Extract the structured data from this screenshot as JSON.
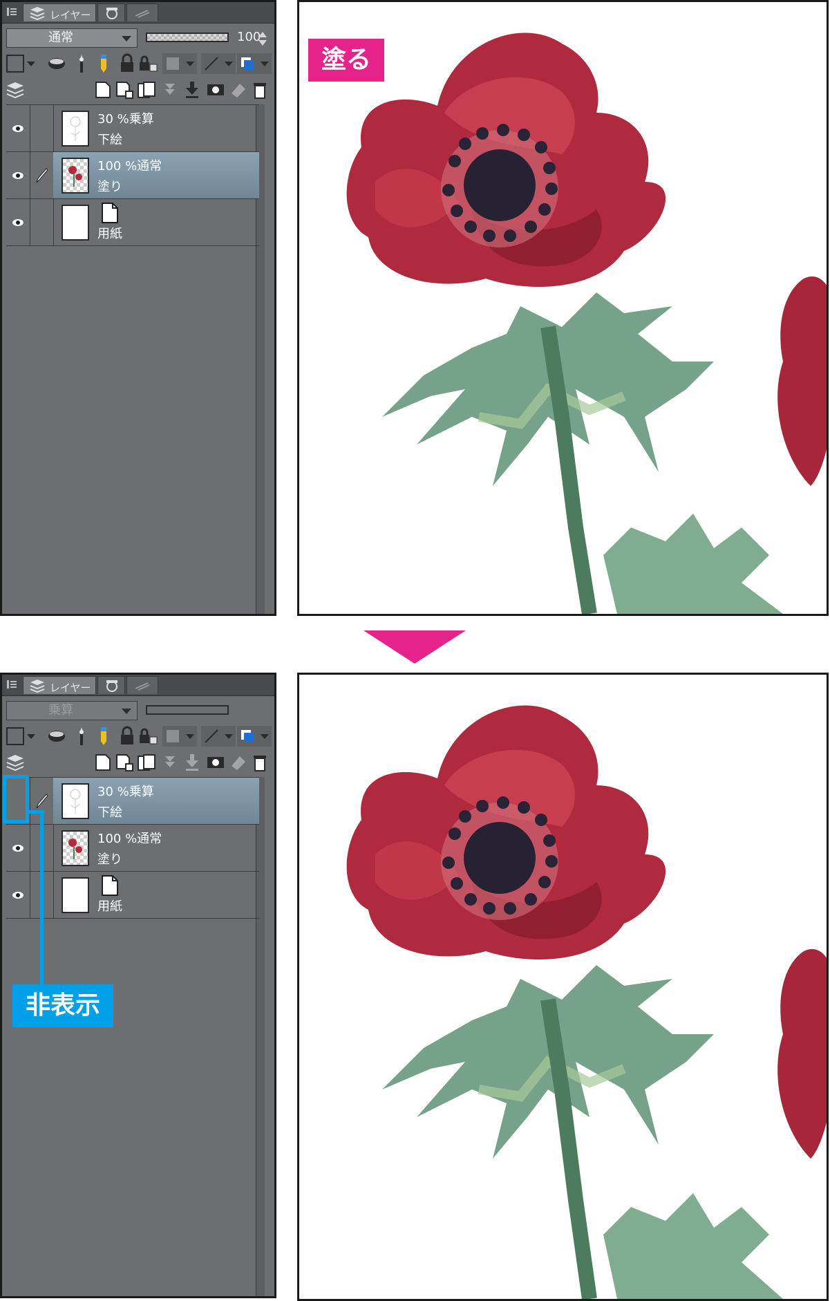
{
  "panel_tab_label": "レイヤー",
  "top_panel": {
    "blend_mode": "通常",
    "opacity": "100",
    "layers": [
      {
        "line1": "30 %乗算",
        "line2": "下絵",
        "visible": true,
        "selected": false,
        "thumb": "sketch"
      },
      {
        "line1": "100 %通常",
        "line2": "塗り",
        "visible": true,
        "selected": true,
        "thumb": "paint"
      },
      {
        "line1": "",
        "line2": "用紙",
        "visible": true,
        "selected": false,
        "thumb": "paper"
      }
    ]
  },
  "bottom_panel": {
    "blend_mode": "乗算",
    "opacity": "",
    "layers": [
      {
        "line1": "30 %乗算",
        "line2": "下絵",
        "visible": false,
        "selected": true,
        "thumb": "sketch"
      },
      {
        "line1": "100 %通常",
        "line2": "塗り",
        "visible": true,
        "selected": false,
        "thumb": "paint"
      },
      {
        "line1": "",
        "line2": "用紙",
        "visible": true,
        "selected": false,
        "thumb": "paper"
      }
    ]
  },
  "annotations": {
    "paint_label": "塗る",
    "hidden_label": "非表示"
  },
  "colors": {
    "accent_pink": "#e6238a",
    "accent_blue": "#00a0e9",
    "panel_bg": "#6c6e71",
    "selected_layer": "#7f97a7"
  }
}
